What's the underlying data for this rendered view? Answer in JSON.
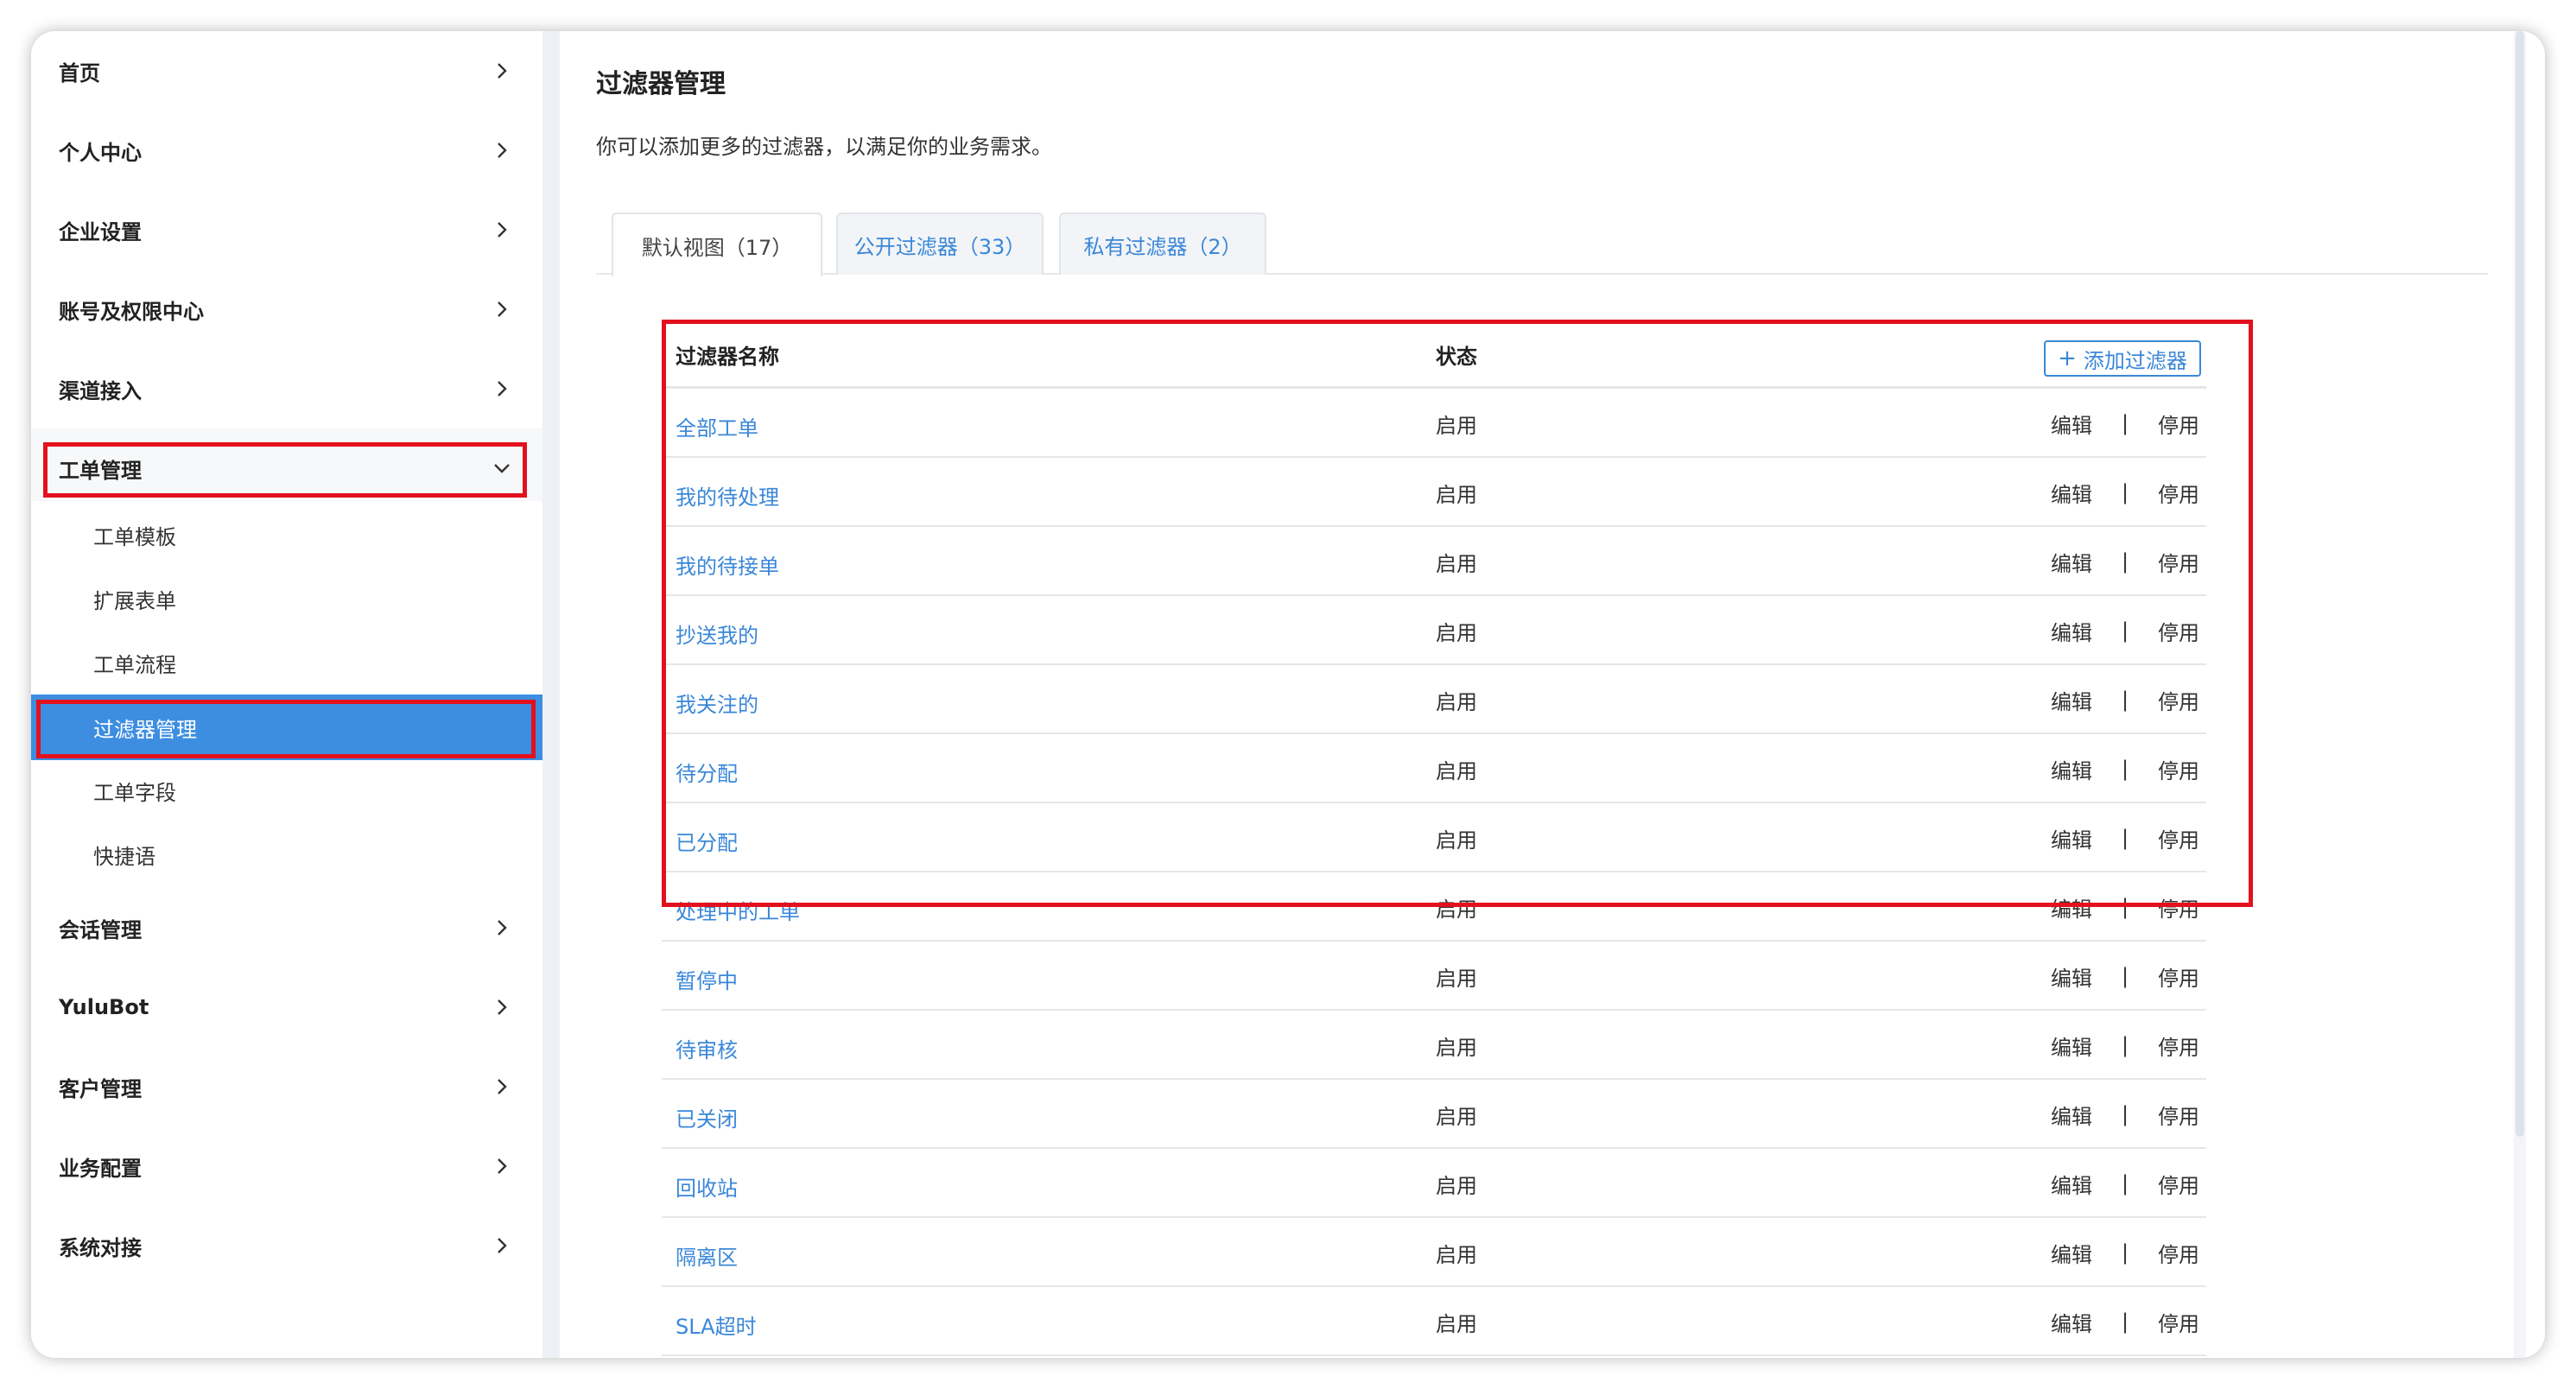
{
  "sidebar": {
    "items": [
      {
        "label": "首页"
      },
      {
        "label": "个人中心"
      },
      {
        "label": "企业设置"
      },
      {
        "label": "账号及权限中心"
      },
      {
        "label": "渠道接入"
      },
      {
        "label": "工单管理"
      },
      {
        "label": "会话管理"
      },
      {
        "label": "YuluBot"
      },
      {
        "label": "客户管理"
      },
      {
        "label": "业务配置"
      },
      {
        "label": "系统对接"
      }
    ],
    "sub_items": [
      {
        "label": "工单模板"
      },
      {
        "label": "扩展表单"
      },
      {
        "label": "工单流程"
      },
      {
        "label": "过滤器管理"
      },
      {
        "label": "工单字段"
      },
      {
        "label": "快捷语"
      }
    ]
  },
  "main": {
    "title": "过滤器管理",
    "description": "你可以添加更多的过滤器，以满足你的业务需求。",
    "tabs": [
      {
        "label": "默认视图（17）"
      },
      {
        "label": "公开过滤器（33）"
      },
      {
        "label": "私有过滤器（2）"
      }
    ],
    "table": {
      "col_name": "过滤器名称",
      "col_status": "状态",
      "add_button": "添加过滤器",
      "add_icon": "+",
      "edit_label": "编辑",
      "separator": "|",
      "disable_label": "停用",
      "rows": [
        {
          "name": "全部工单",
          "status": "启用"
        },
        {
          "name": "我的待处理",
          "status": "启用"
        },
        {
          "name": "我的待接单",
          "status": "启用"
        },
        {
          "name": "抄送我的",
          "status": "启用"
        },
        {
          "name": "我关注的",
          "status": "启用"
        },
        {
          "name": "待分配",
          "status": "启用"
        },
        {
          "name": "已分配",
          "status": "启用"
        },
        {
          "name": "处理中的工单",
          "status": "启用"
        },
        {
          "name": "暂停中",
          "status": "启用"
        },
        {
          "name": "待审核",
          "status": "启用"
        },
        {
          "name": "已关闭",
          "status": "启用"
        },
        {
          "name": "回收站",
          "status": "启用"
        },
        {
          "name": "隔离区",
          "status": "启用"
        },
        {
          "name": "SLA超时",
          "status": "启用"
        }
      ]
    }
  },
  "colors": {
    "accent": "#3a87d8",
    "active_menu": "#3d8ee0",
    "highlight_box": "#e3101d"
  }
}
